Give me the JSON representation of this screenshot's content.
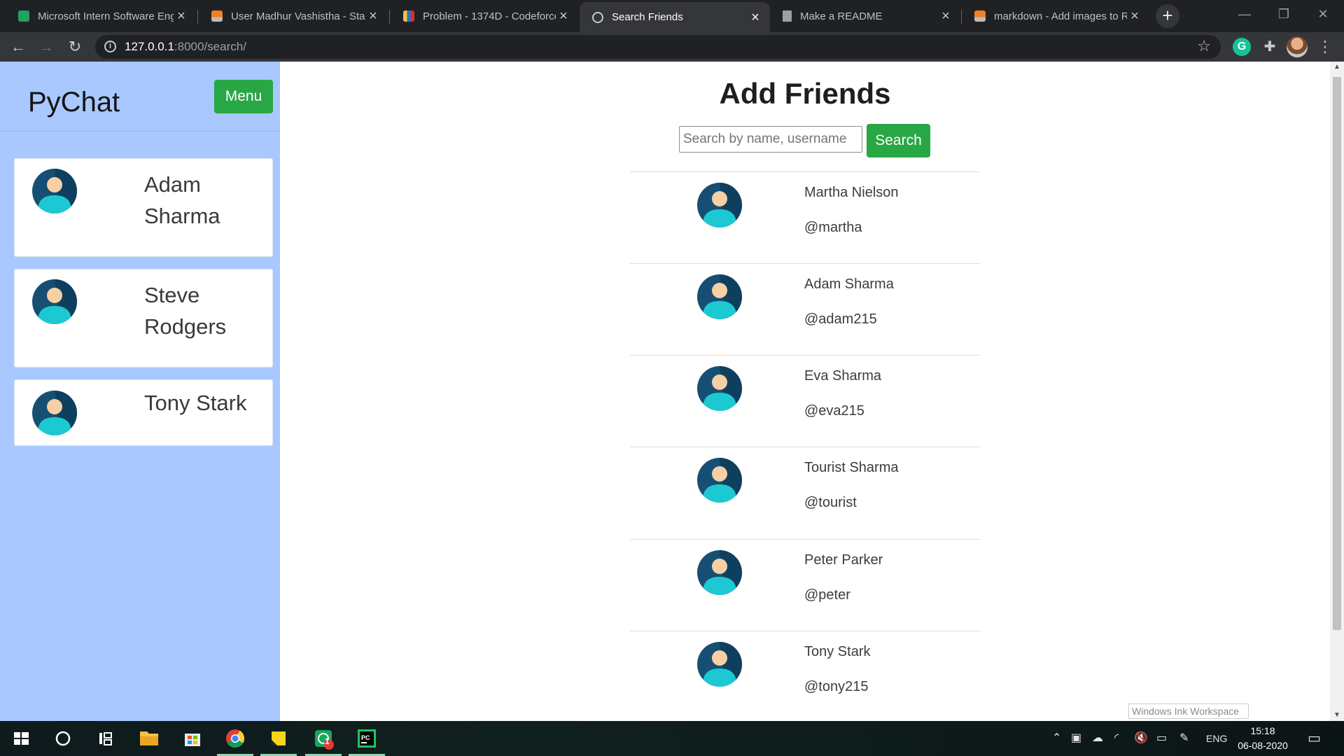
{
  "browser": {
    "tabs": [
      {
        "title": "Microsoft Intern Software Eng",
        "favicon": "green-document-icon",
        "active": false
      },
      {
        "title": "User Madhur Vashistha - Stac",
        "favicon": "stackoverflow-icon",
        "active": false
      },
      {
        "title": "Problem - 1374D - Codeforce",
        "favicon": "codeforces-icon",
        "active": false
      },
      {
        "title": "Search Friends",
        "favicon": "globe-icon",
        "active": true
      },
      {
        "title": "Make a README",
        "favicon": "document-icon",
        "active": false
      },
      {
        "title": "markdown - Add images to R",
        "favicon": "stackoverflow-icon",
        "active": false
      }
    ],
    "url_host": "127.0.0.1",
    "url_rest": ":8000/search/",
    "extension_letter": "G"
  },
  "sidebar": {
    "brand": "PyChat",
    "menu_label": "Menu",
    "friends": [
      {
        "line1": "Adam",
        "line2": "Sharma"
      },
      {
        "line1": "Steve",
        "line2": "Rodgers"
      },
      {
        "line1": "Tony Stark",
        "line2": ""
      }
    ]
  },
  "main": {
    "title": "Add Friends",
    "search_placeholder": "Search by name, username",
    "search_value": "",
    "search_button": "Search",
    "results": [
      {
        "name": "Martha Nielson",
        "username": "@martha"
      },
      {
        "name": "Adam Sharma",
        "username": "@adam215"
      },
      {
        "name": "Eva Sharma",
        "username": "@eva215"
      },
      {
        "name": "Tourist Sharma",
        "username": "@tourist"
      },
      {
        "name": "Peter Parker",
        "username": "@peter"
      },
      {
        "name": "Tony Stark",
        "username": "@tony215"
      }
    ]
  },
  "ink_tooltip": "Windows Ink Workspace",
  "taskbar": {
    "language": "ENG",
    "time": "15:18",
    "date": "06-08-2020",
    "notification_badge": "1"
  },
  "colors": {
    "sidebar_bg": "#a8c8ff",
    "accent_green": "#28a745",
    "avatar_dark": "#164f73",
    "avatar_body": "#1cc9d2",
    "avatar_face": "#f7cfa4"
  }
}
